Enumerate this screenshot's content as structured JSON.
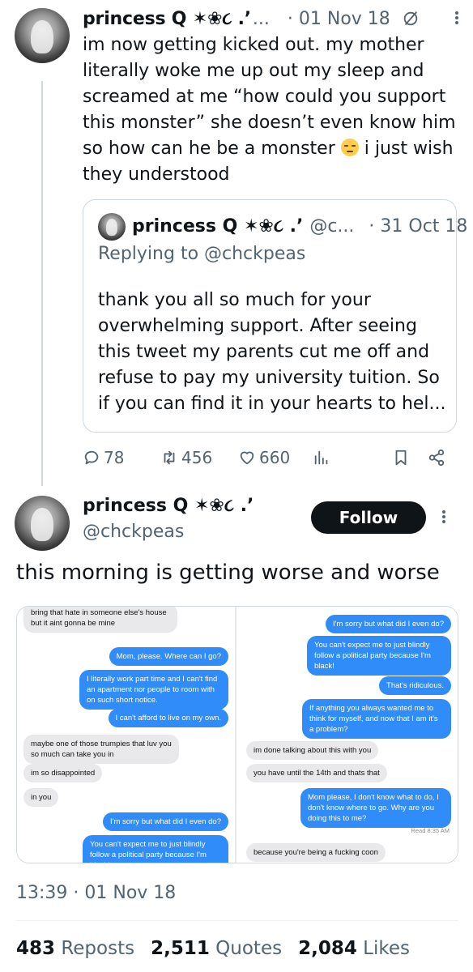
{
  "reply_tweet": {
    "display_name": "princess Q ✶❀૮ .’",
    "name_ellipsis": "...",
    "date": "· 01 Nov 18",
    "text_before_emoji": "im now getting kicked out. my mother literally woke me up out my sleep and screamed at me “how could you support this monster” she doesn’t even know him so how can he be a monster ",
    "text_after_emoji": " i just wish they understood",
    "quote": {
      "display_name": "princess Q ✶❀૮ .’",
      "handle": "@c...",
      "date": "· 31 Oct 18",
      "replying_to": "Replying to @chckpeas",
      "text": "thank you all so much for your overwhelming support. After seeing this tweet my parents cut me off and refuse to pay my university tuition. So if you can find it in your hearts to hel..."
    },
    "actions": {
      "replies": "78",
      "reposts": "456",
      "likes": "660"
    }
  },
  "main_tweet": {
    "display_name": "princess Q ✶❀૮ .’",
    "handle": "@chckpeas",
    "follow_label": "Follow",
    "text": "this morning is getting worse and worse",
    "media_left": [
      "bring that hate in someone else's house but it aint gonna be mine",
      "Mom, please. Where can I go?",
      "I literally work part time and I can't find an apartment nor people to room with on such short notice.",
      "I can't afford to live on my own.",
      "maybe one of those trumpies that luv you so much can take you in",
      "im so disappointed",
      "in you",
      "I'm sorry but what did I even do?",
      "You can't expect me to just blindly follow a political party because I'm black!"
    ],
    "media_right": [
      "I'm sorry but what did I even do?",
      "You can't expect me to just blindly follow a political party because I'm black!",
      "That's ridiculous.",
      "If anything you always wanted me to think for myself, and now that I am it's a problem?",
      "im done talking about this with you",
      "you have until the 14th and thats that",
      "Mom please, I don't know what to do, I don't know where to go. Why are you doing this to me?",
      "Read 8:35 AM",
      "because you're being a fucking coon"
    ],
    "timestamp": "13:39 · 01 Nov 18",
    "stats": {
      "reposts_count": "483",
      "reposts_label": "Reposts",
      "quotes_count": "2,511",
      "quotes_label": "Quotes",
      "likes_count": "2,084",
      "likes_label": "Likes"
    }
  }
}
